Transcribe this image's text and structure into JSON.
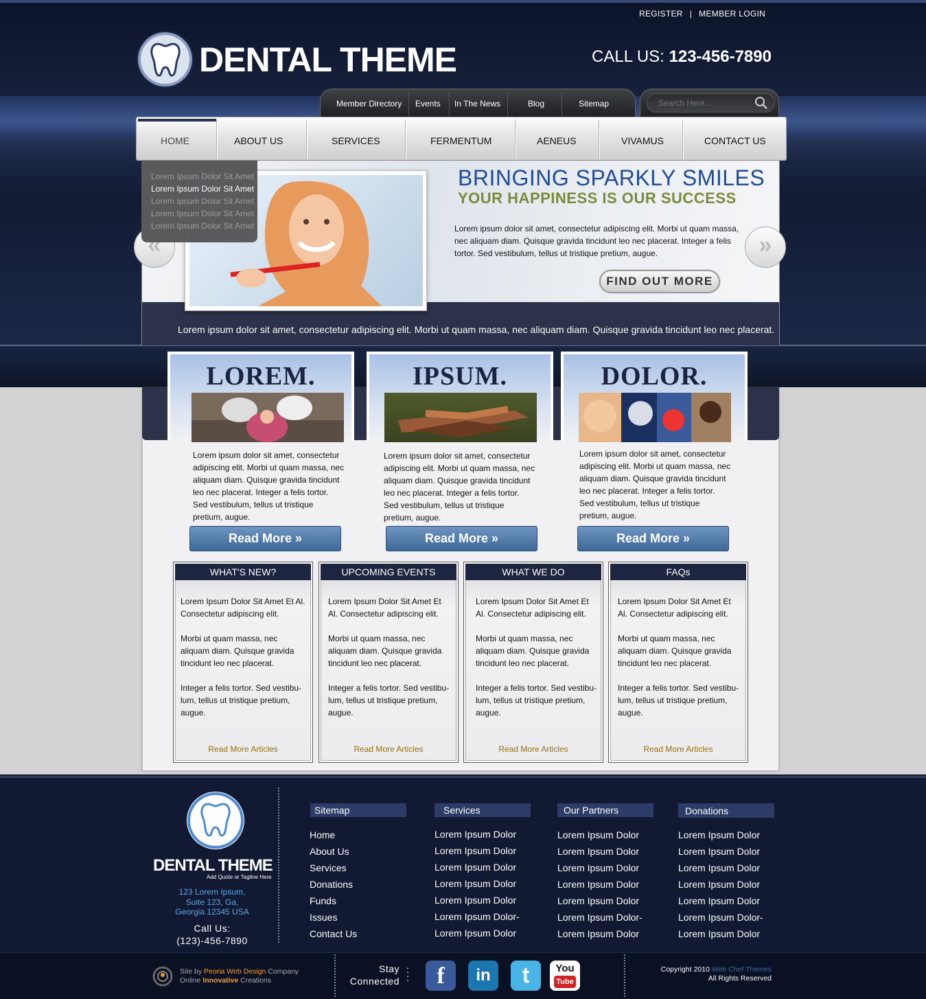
{
  "header": {
    "top_links": [
      "REGISTER",
      "MEMBER LOGIN"
    ],
    "top_sep": "|",
    "logo_text": "DENTAL THEME",
    "call_label": "CALL US:",
    "call_number": "123-456-7890",
    "subnav": [
      "Member Directory",
      "Events",
      "In The News",
      "Blog",
      "Sitemap"
    ],
    "search_placeholder": "Search Here...",
    "mainnav": [
      "HOME",
      "ABOUT US",
      "SERVICES",
      "FERMENTUM",
      "AENEUS",
      "VIVAMUS",
      "CONTACT US"
    ],
    "mainnav_active": "HOME",
    "dropdown": [
      "Lorem Ipsum Dolor Sit Amet",
      "Lorem Ipsum Dolor Sit Amet",
      "Lorem Ipsum Dolor Sit Amet",
      "Lorem Ipsum Dolor Sit Amet",
      "Lorem Ipsum Dolor Sit Amet"
    ]
  },
  "slider": {
    "heading": "BRINGING SPARKLY SMILES",
    "subheading": "YOUR HAPPINESS IS OUR SUCCESS",
    "description": "Lorem ipsum dolor sit amet, consectetur adipiscing elit. Morbi ut quam massa, nec aliquam diam. Quisque gravida tincidunt leo nec placerat. Integer a felis tortor. Sed vestibulum, tellus ut tristique pretium, augue.",
    "button": "FIND OUT MORE",
    "prev_icon": "«",
    "next_icon": "»",
    "caption": "Lorem ipsum dolor sit amet, consectetur adipiscing elit. Morbi ut quam massa, nec aliquam diam. Quisque gravida tincidunt leo nec placerat."
  },
  "features": [
    {
      "title": "LOREM.",
      "text": "Lorem ipsum dolor sit amet, consectetur adipiscing elit. Morbi ut quam massa, nec aliquam diam. Quisque gravida tincidunt leo nec placerat. Integer a felis tortor. Sed vestibulum, tellus ut tristique pretium, augue.",
      "button": "Read More »"
    },
    {
      "title": "IPSUM.",
      "text": "Lorem ipsum dolor sit amet, consectetur adipiscing elit. Morbi ut quam massa, nec aliquam diam. Quisque gravida tincidunt leo nec placerat. Integer a felis tortor. Sed vestibulum, tellus ut tristique pretium, augue.",
      "button": "Read More »"
    },
    {
      "title": "DOLOR.",
      "text": "Lorem ipsum dolor sit amet, consectetur adipiscing elit. Morbi ut quam massa, nec aliquam diam. Quisque gravida tincidunt leo nec placerat. Integer a felis tortor. Sed vestibulum, tellus ut tristique pretium, augue.",
      "button": "Read More »"
    }
  ],
  "boxes": [
    {
      "title": "WHAT'S NEW?",
      "p1": "Lorem Ipsum Dolor Sit Amet Et Al. Consectetur adipiscing elit.",
      "p2": "Morbi ut quam massa, nec aliquam diam. Quisque gravida tincidunt leo nec placerat.",
      "p3": "Integer a felis tortor. Sed vestibu-lum, tellus ut tristique pretium, augue.",
      "link": "Read More Articles"
    },
    {
      "title": "UPCOMING EVENTS",
      "p1": "Lorem Ipsum Dolor Sit Amet Et Al. Consectetur adipiscing elit.",
      "p2": "Morbi ut quam massa, nec aliquam diam. Quisque gravida tincidunt leo nec placerat.",
      "p3": "Integer a felis tortor. Sed vestibu-lum, tellus ut tristique pretium, augue.",
      "link": "Read More Articles"
    },
    {
      "title": "WHAT WE DO",
      "p1": "Lorem Ipsum Dolor Sit Amet Et Al. Consectetur adipiscing elit.",
      "p2": "Morbi ut quam massa, nec aliquam diam. Quisque gravida tincidunt leo nec placerat.",
      "p3": "Integer a felis tortor. Sed vestibu-lum, tellus ut tristique pretium, augue.",
      "link": "Read More Articles"
    },
    {
      "title": "FAQs",
      "p1": "Lorem Ipsum Dolor Sit Amet Et Al. Consectetur adipiscing elit.",
      "p2": "Morbi ut quam massa, nec aliquam diam. Quisque gravida tincidunt leo nec placerat.",
      "p3": "Integer a felis tortor. Sed vestibu-lum, tellus ut tristique pretium, augue.",
      "link": "Read More Articles"
    }
  ],
  "footer": {
    "logo_text": "DENTAL THEME",
    "tagline": "Add Quote or Tagline Here",
    "address": [
      "123 Lorem Ipsum,",
      "Suite 123, Ga,",
      "Georgia 12345 USA"
    ],
    "call_label": "Call Us:",
    "call_number": "(123)-456-7890",
    "columns": [
      {
        "title": "Sitemap",
        "items": [
          "Home",
          "About Us",
          "Services",
          "Donations",
          "Funds",
          "Issues",
          "Contact Us"
        ]
      },
      {
        "title": "Services",
        "items": [
          "Lorem Ipsum Dolor",
          "Lorem Ipsum Dolor",
          "Lorem Ipsum Dolor",
          "Lorem Ipsum Dolor",
          "Lorem Ipsum Dolor",
          "Lorem Ipsum Dolor-",
          "Lorem Ipsum Dolor"
        ]
      },
      {
        "title": "Our Partners",
        "items": [
          "Lorem Ipsum Dolor",
          "Lorem Ipsum Dolor",
          "Lorem Ipsum Dolor",
          "Lorem Ipsum Dolor",
          "Lorem Ipsum Dolor",
          "Lorem Ipsum Dolor-",
          "Lorem Ipsum Dolor"
        ]
      },
      {
        "title": "Donations",
        "items": [
          "Lorem Ipsum Dolor",
          "Lorem Ipsum Dolor",
          "Lorem Ipsum Dolor",
          "Lorem Ipsum Dolor",
          "Lorem Ipsum Dolor",
          "Lorem Ipsum Dolor-",
          "Lorem Ipsum Dolor"
        ]
      }
    ],
    "credit_site_by": "Site by",
    "credit_company": "Peoria Web Design",
    "credit_company_suffix": "Company",
    "credit_line2_a": "Online",
    "credit_line2_b": "Innovative",
    "credit_line2_c": "Creations",
    "stay_connected": [
      "Stay",
      "Connected"
    ],
    "social": [
      {
        "name": "facebook-icon",
        "glyph": "f",
        "color": "#3b5a9c"
      },
      {
        "name": "linkedin-icon",
        "glyph": "in",
        "color": "#1c77b0"
      },
      {
        "name": "twitter-icon",
        "glyph": "t",
        "color": "#4ab4e6"
      },
      {
        "name": "youtube-icon",
        "glyph": "You",
        "glyph2": "Tube",
        "color": "#d32224"
      }
    ],
    "copyright_prefix": "Copyright 2010",
    "copyright_brand": "Web Chef Themes",
    "rights": "All Rights Reserved"
  }
}
